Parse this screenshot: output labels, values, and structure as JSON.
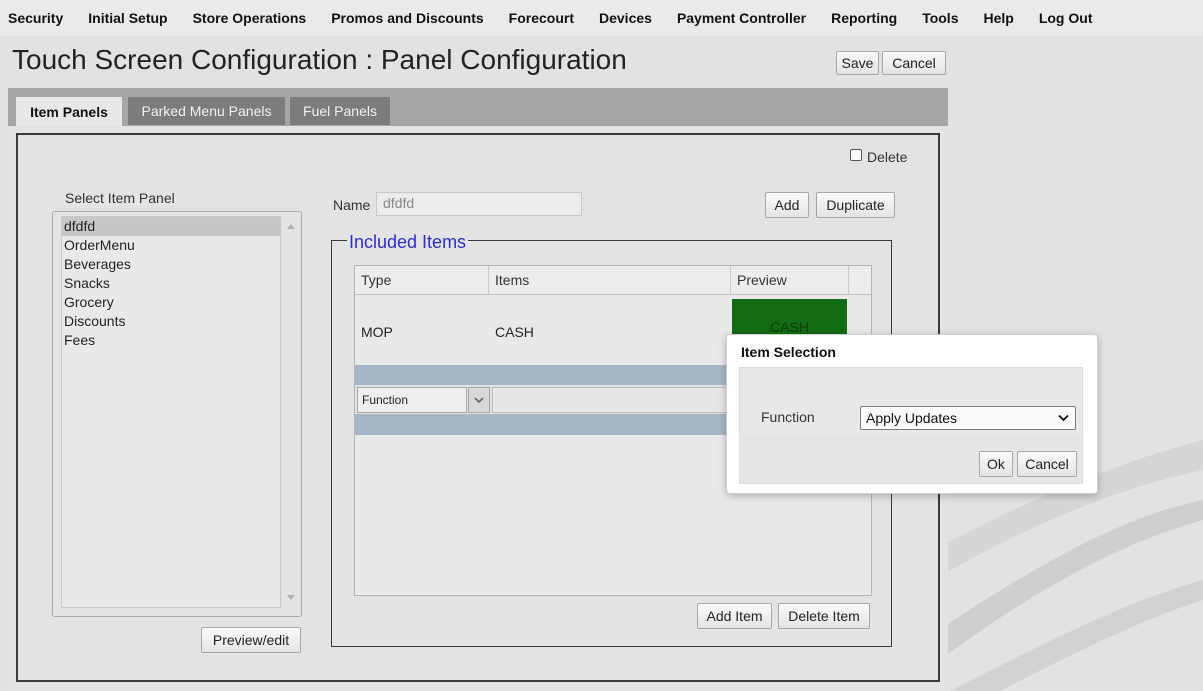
{
  "nav": {
    "items": [
      "Security",
      "Initial Setup",
      "Store Operations",
      "Promos and Discounts",
      "Forecourt",
      "Devices",
      "Payment Controller",
      "Reporting",
      "Tools",
      "Help",
      "Log Out"
    ]
  },
  "header": {
    "title": "Touch Screen Configuration : Panel Configuration",
    "save_label": "Save",
    "cancel_label": "Cancel"
  },
  "tabs": [
    "Item Panels",
    "Parked Menu Panels",
    "Fuel Panels"
  ],
  "panel": {
    "delete_label": "Delete",
    "delete_checked": false,
    "select_label": "Select Item Panel",
    "items": [
      "dfdfd",
      "OrderMenu",
      "Beverages",
      "Snacks",
      "Grocery",
      "Discounts",
      "Fees"
    ],
    "selected_index": 0,
    "preview_edit_label": "Preview/edit",
    "name_label": "Name",
    "name_value": "dfdfd",
    "add_label": "Add",
    "duplicate_label": "Duplicate"
  },
  "included": {
    "legend": "Included Items",
    "columns": [
      "Type",
      "Items",
      "Preview"
    ],
    "rows": [
      {
        "type": "MOP",
        "item": "CASH",
        "preview": "CASH",
        "preview_color": "#136c13"
      }
    ],
    "edit_type_value": "Function",
    "add_item_label": "Add Item",
    "delete_item_label": "Delete Item"
  },
  "modal": {
    "title": "Item Selection",
    "field_label": "Function",
    "field_value": "Apply Updates",
    "ok_label": "Ok",
    "cancel_label": "Cancel"
  },
  "colors": {
    "accent_legend": "#2d2dc8",
    "preview_green": "#136c13",
    "edit_row_blue": "#a6b6c5"
  }
}
